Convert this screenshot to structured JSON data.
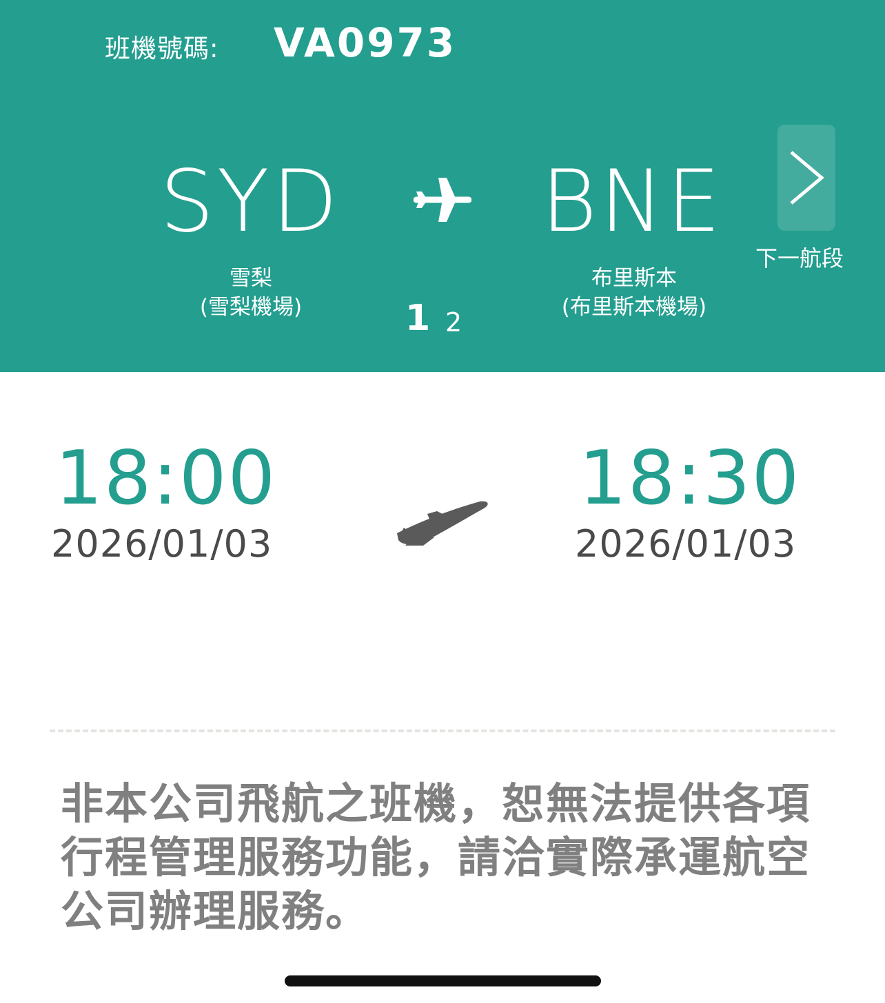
{
  "header": {
    "flight_label": "班機號碼:",
    "flight_number": "VA0973",
    "origin": {
      "code": "SYD",
      "city": "雪梨",
      "airport": "(雪梨機場)"
    },
    "destination": {
      "code": "BNE",
      "city": "布里斯本",
      "airport": "(布里斯本機場)"
    },
    "next_segment_label": "下一航段",
    "pages": {
      "current": "1",
      "other": "2"
    },
    "background_color": "#239E8F"
  },
  "schedule": {
    "departure": {
      "time": "18:00",
      "date": "2026/01/03"
    },
    "arrival": {
      "time": "18:30",
      "date": "2026/01/03"
    },
    "time_color": "#239E8F"
  },
  "notice": "非本公司飛航之班機，恕無法提供各項行程管理服務功能，請洽實際承運航空公司辦理服務。",
  "icons": {
    "header_plane": "airplane-icon",
    "body_plane": "airplane-takeoff-icon",
    "next": "chevron-right-icon"
  }
}
